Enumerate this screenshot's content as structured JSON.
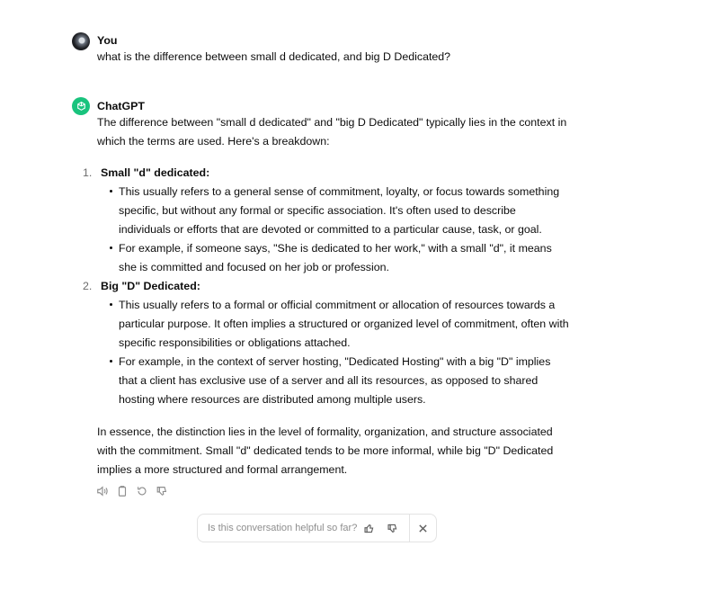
{
  "user_message": {
    "author": "You",
    "text": "what is the difference between small d dedicated, and big D Dedicated?"
  },
  "assistant_message": {
    "author": "ChatGPT",
    "intro": "The difference between \"small d dedicated\" and \"big D Dedicated\" typically lies in the context in which the terms are used. Here's a breakdown:",
    "items": [
      {
        "number": "1.",
        "title": "Small \"d\" dedicated:",
        "bullets": [
          "This usually refers to a general sense of commitment, loyalty, or focus towards something specific, but without any formal or specific association. It's often used to describe individuals or efforts that are devoted or committed to a particular cause, task, or goal.",
          "For example, if someone says, \"She is dedicated to her work,\" with a small \"d\", it means she is committed and focused on her job or profession."
        ]
      },
      {
        "number": "2.",
        "title": "Big \"D\" Dedicated:",
        "bullets": [
          "This usually refers to a formal or official commitment or allocation of resources towards a particular purpose. It often implies a structured or organized level of commitment, often with specific responsibilities or obligations attached.",
          "For example, in the context of server hosting, \"Dedicated Hosting\" with a big \"D\" implies that a client has exclusive use of a server and all its resources, as opposed to shared hosting where resources are distributed among multiple users."
        ]
      }
    ],
    "summary": "In essence, the distinction lies in the level of formality, organization, and structure associated with the commitment. Small \"d\" dedicated tends to be more informal, while big \"D\" Dedicated implies a more structured and formal arrangement."
  },
  "message_actions": [
    "read-aloud-icon",
    "copy-icon",
    "regenerate-icon",
    "thumbs-down-icon"
  ],
  "feedback_bar": {
    "question": "Is this conversation helpful so far?",
    "icons": [
      "thumbs-up-icon",
      "thumbs-down-icon",
      "close-icon"
    ]
  },
  "colors": {
    "text": "#0d0d0d",
    "muted": "#8e8e8e",
    "chatgpt_avatar": "#19c37d",
    "border": "#e3e3e3"
  }
}
